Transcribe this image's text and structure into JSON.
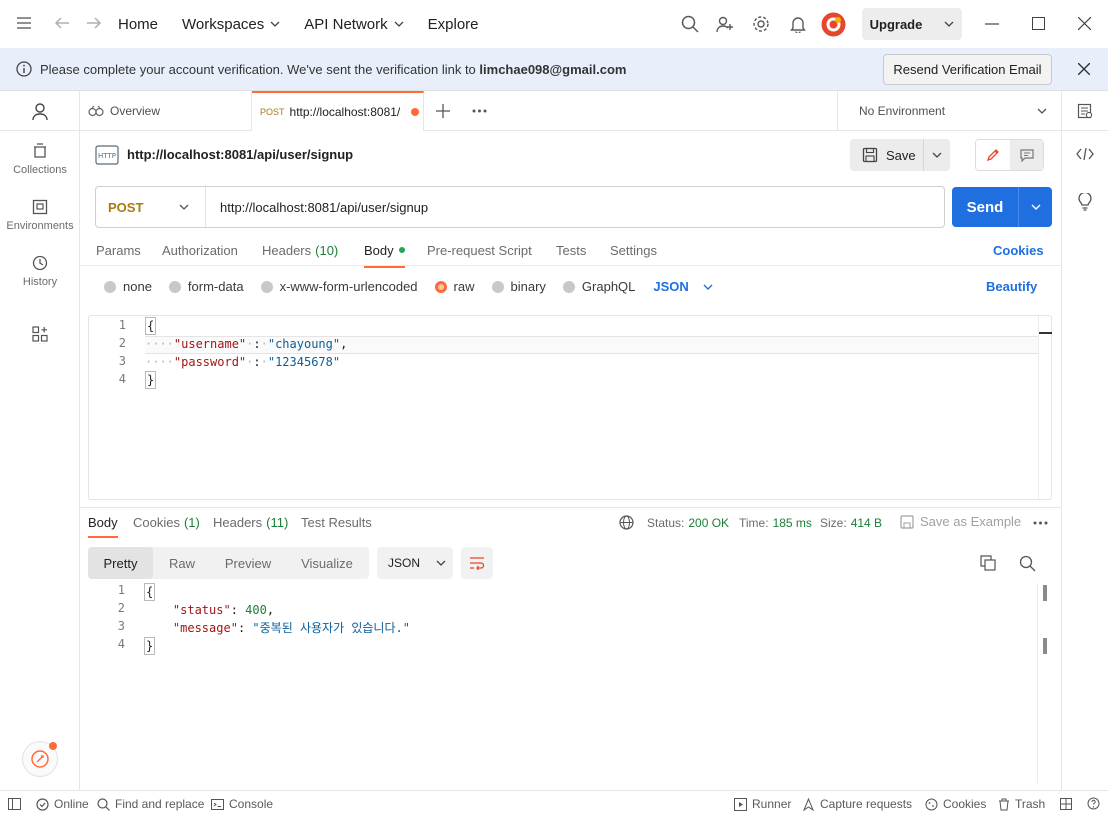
{
  "topbar": {
    "nav": [
      "Home",
      "Workspaces",
      "API Network",
      "Explore"
    ],
    "upgrade_label": "Upgrade"
  },
  "banner": {
    "message": "Please complete your account verification. We've sent the verification link to ",
    "email": "limchae098@gmail.com",
    "resend_label": "Resend Verification Email"
  },
  "sidebar": {
    "items": [
      {
        "label": "Collections",
        "icon": "collections-icon"
      },
      {
        "label": "Environments",
        "icon": "environments-icon"
      },
      {
        "label": "History",
        "icon": "history-icon"
      }
    ]
  },
  "tabs": {
    "overview": "Overview",
    "active_method": "POST",
    "active_url": "http://localhost:8081/",
    "environment": "No Environment"
  },
  "request": {
    "name": "http://localhost:8081/api/user/signup",
    "save_label": "Save",
    "method": "POST",
    "url": "http://localhost:8081/api/user/signup",
    "send_label": "Send",
    "subtabs": [
      "Params",
      "Authorization",
      "Headers",
      "Body",
      "Pre-request Script",
      "Tests",
      "Settings"
    ],
    "headers_count": "(10)",
    "cookies_label": "Cookies",
    "body_modes": [
      "none",
      "form-data",
      "x-www-form-urlencoded",
      "raw",
      "binary",
      "GraphQL"
    ],
    "body_format": "JSON",
    "beautify_label": "Beautify",
    "lines": [
      "1",
      "2",
      "3",
      "4"
    ],
    "code": {
      "open": "{",
      "key1": "\"username\"",
      "val1": "\"chayoung\"",
      "key2": "\"password\"",
      "val2": "\"12345678\"",
      "close": "}"
    }
  },
  "response": {
    "tabs": [
      "Body",
      "Cookies",
      "Headers",
      "Test Results"
    ],
    "cookies_count": "(1)",
    "headers_count": "(11)",
    "status_label": "Status:",
    "status_value": "200 OK",
    "time_label": "Time:",
    "time_value": "185 ms",
    "size_label": "Size:",
    "size_value": "414 B",
    "save_example_label": "Save as Example",
    "views": [
      "Pretty",
      "Raw",
      "Preview",
      "Visualize"
    ],
    "format": "JSON",
    "lines": [
      "1",
      "2",
      "3",
      "4"
    ],
    "code": {
      "open": "{",
      "key1": "\"status\"",
      "val1": "400",
      "key2": "\"message\"",
      "val2": "\"중복된 사용자가 있습니다.\"",
      "close": "}"
    }
  },
  "statusbar": {
    "online": "Online",
    "find": "Find and replace",
    "console": "Console",
    "runner": "Runner",
    "capture": "Capture requests",
    "cookies": "Cookies",
    "trash": "Trash"
  },
  "colors": {
    "accent": "#ff6c37",
    "send": "#1f6fe0",
    "method": "#a67c10",
    "status_ok": "#1a7f37",
    "link": "#1f6fe0"
  }
}
